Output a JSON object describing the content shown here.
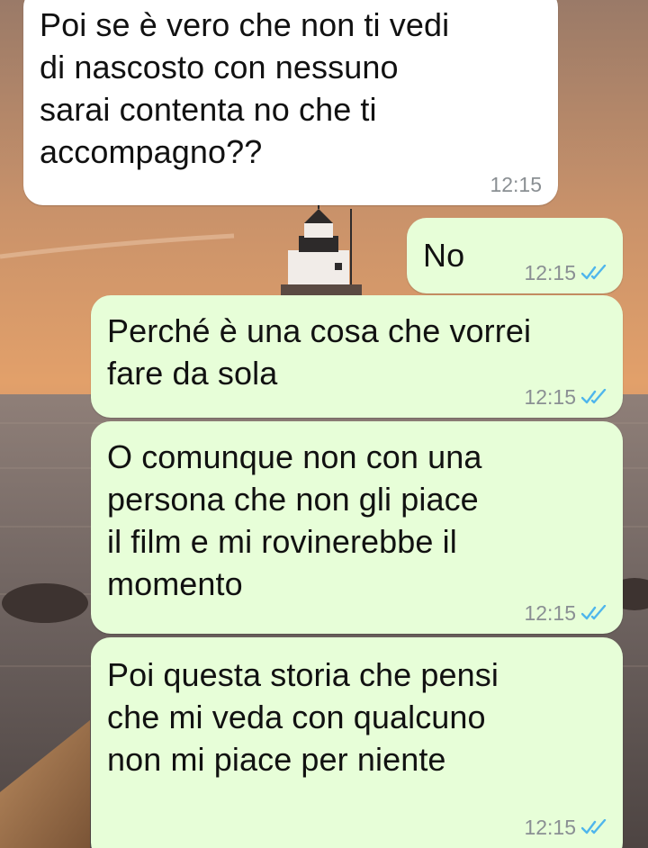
{
  "colors": {
    "incoming_bubble": "#ffffff",
    "outgoing_bubble": "#e7fed8",
    "read_ticks": "#4fb6ec",
    "timestamp": "#8a8f93"
  },
  "wallpaper": {
    "description_icon": "sunset-lighthouse-wallpaper"
  },
  "messages": [
    {
      "direction": "incoming",
      "text": "Poi se è vero che non ti vedi\ndi nascosto con nessuno\nsarai contenta no che ti\naccompagno??",
      "time": "12:15"
    },
    {
      "direction": "outgoing",
      "text": "No",
      "time": "12:15",
      "status": "read-double-tick-icon"
    },
    {
      "direction": "outgoing",
      "text": "Perché è una cosa che vorrei\nfare da sola",
      "time": "12:15",
      "status": "read-double-tick-icon"
    },
    {
      "direction": "outgoing",
      "text": "O comunque non con una\npersona che non gli piace\nil film e mi rovinerebbe il\nmomento",
      "time": "12:15",
      "status": "read-double-tick-icon"
    },
    {
      "direction": "outgoing",
      "text": "Poi questa storia che pensi\nche mi veda con qualcuno\nnon mi piace per niente",
      "time": "12:15",
      "status": "read-double-tick-icon"
    }
  ]
}
